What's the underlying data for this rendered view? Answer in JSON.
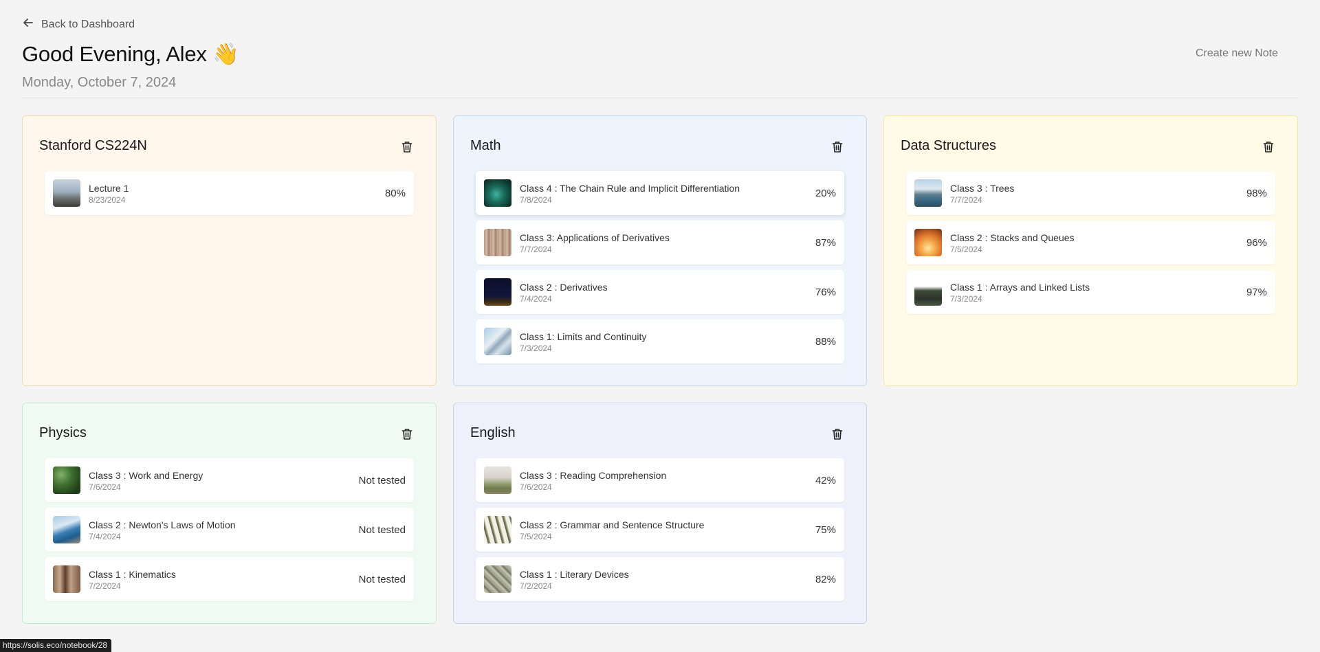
{
  "header": {
    "back_label": "Back to Dashboard",
    "greeting": "Good Evening, Alex 👋",
    "date": "Monday, October 7, 2024",
    "create_label": "Create new Note"
  },
  "colors": {
    "orange_bg": "#fff6ec",
    "orange_border": "#f6d8b3",
    "blue_bg": "#eef4fd",
    "blue_border": "#c7d9f2",
    "yellow_bg": "#fffbe6",
    "yellow_border": "#f6e6a7",
    "green_bg": "#effbf2",
    "green_border": "#c2ecd0",
    "indigo_bg": "#eef1fb",
    "indigo_border": "#cdd3ef"
  },
  "cards": [
    {
      "title": "Stanford CS224N",
      "entries": [
        {
          "title": "Lecture 1",
          "date": "8/23/2024",
          "score": "80%"
        }
      ]
    },
    {
      "title": "Math",
      "entries": [
        {
          "title": "Class 4 : The Chain Rule and Implicit Differentiation",
          "date": "7/8/2024",
          "score": "20%"
        },
        {
          "title": "Class 3: Applications of Derivatives",
          "date": "7/7/2024",
          "score": "87%"
        },
        {
          "title": "Class 2 : Derivatives",
          "date": "7/4/2024",
          "score": "76%"
        },
        {
          "title": "Class 1: Limits and Continuity",
          "date": "7/3/2024",
          "score": "88%"
        }
      ]
    },
    {
      "title": "Data Structures",
      "entries": [
        {
          "title": "Class 3 : Trees",
          "date": "7/7/2024",
          "score": "98%"
        },
        {
          "title": "Class 2 : Stacks and Queues",
          "date": "7/5/2024",
          "score": "96%"
        },
        {
          "title": "Class 1 : Arrays and Linked Lists",
          "date": "7/3/2024",
          "score": "97%"
        }
      ]
    },
    {
      "title": "Physics",
      "entries": [
        {
          "title": "Class 3 : Work and Energy",
          "date": "7/6/2024",
          "score": "Not tested"
        },
        {
          "title": "Class 2 : Newton's Laws of Motion",
          "date": "7/4/2024",
          "score": "Not tested"
        },
        {
          "title": "Class 1 : Kinematics",
          "date": "7/2/2024",
          "score": "Not tested"
        }
      ]
    },
    {
      "title": "English",
      "entries": [
        {
          "title": "Class 3 : Reading Comprehension",
          "date": "7/6/2024",
          "score": "42%"
        },
        {
          "title": "Class 2 : Grammar and Sentence Structure",
          "date": "7/5/2024",
          "score": "75%"
        },
        {
          "title": "Class 1 : Literary Devices",
          "date": "7/2/2024",
          "score": "82%"
        }
      ]
    }
  ],
  "status_bar": {
    "url": "https://solis.eco/notebook/28"
  }
}
